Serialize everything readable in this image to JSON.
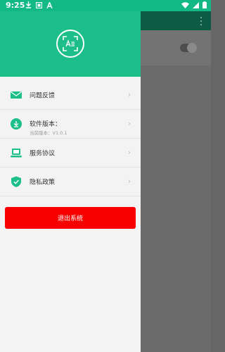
{
  "statusbar": {
    "time": "9:25",
    "icons_left": [
      "download-icon",
      "image-icon",
      "a-icon"
    ],
    "icons_right": [
      "wifi-icon",
      "signal-icon",
      "battery-icon"
    ]
  },
  "colors": {
    "header_green": "#1cbe8a",
    "logout_red": "#f80000"
  },
  "drawer": {
    "logo_icon": "scan-text-icon",
    "menu": [
      {
        "label": "问题反馈",
        "icon": "mail-icon"
      },
      {
        "label": "软件版本：",
        "subtitle": "当前版本：V1.0.1",
        "icon": "download-icon"
      },
      {
        "label": "服务协议",
        "icon": "laptop-icon"
      },
      {
        "label": "隐私政策",
        "icon": "shield-icon"
      }
    ],
    "logout_label": "退出系统"
  }
}
